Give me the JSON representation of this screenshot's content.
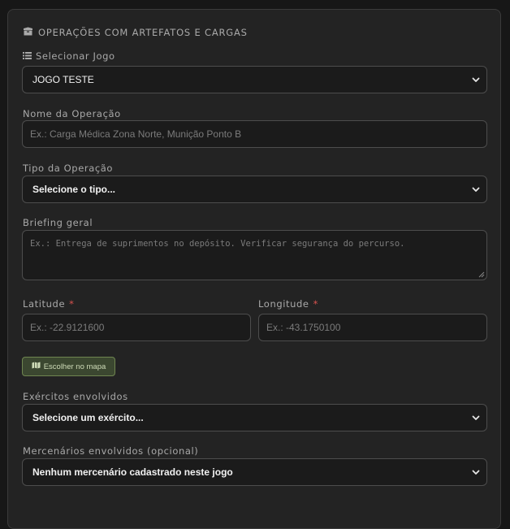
{
  "section": {
    "title": "OPERAÇÕES COM ARTEFATOS E CARGAS",
    "icon": "box-icon"
  },
  "game": {
    "label": "Selecionar Jogo",
    "icon": "list-icon",
    "selected": "JOGO TESTE"
  },
  "operation_name": {
    "label": "Nome da Operação",
    "placeholder": "Ex.: Carga Médica Zona Norte, Munição Ponto B"
  },
  "operation_type": {
    "label": "Tipo da Operação",
    "selected": "Selecione o tipo..."
  },
  "briefing": {
    "label": "Briefing geral",
    "placeholder": "Ex.: Entrega de suprimentos no depósito. Verificar segurança do percurso."
  },
  "latitude": {
    "label": "Latitude",
    "required_mark": "*",
    "placeholder": "Ex.: -22.9121600"
  },
  "longitude": {
    "label": "Longitude",
    "required_mark": "*",
    "placeholder": "Ex.: -43.1750100"
  },
  "map_button": {
    "label": "Escolher no mapa",
    "icon": "map-icon"
  },
  "armies": {
    "label": "Exércitos envolvidos",
    "selected": "Selecione um exército..."
  },
  "mercenaries": {
    "label": "Mercenários envolvidos (opcional)",
    "selected": "Nenhum mercenário cadastrado neste jogo"
  },
  "colors": {
    "background": "#171717",
    "panel": "#232323",
    "field": "#1b1b1b",
    "border": "#4d4d4d",
    "required": "#d9534f",
    "button_bg": "#3b4730",
    "button_border": "#6f8650"
  }
}
